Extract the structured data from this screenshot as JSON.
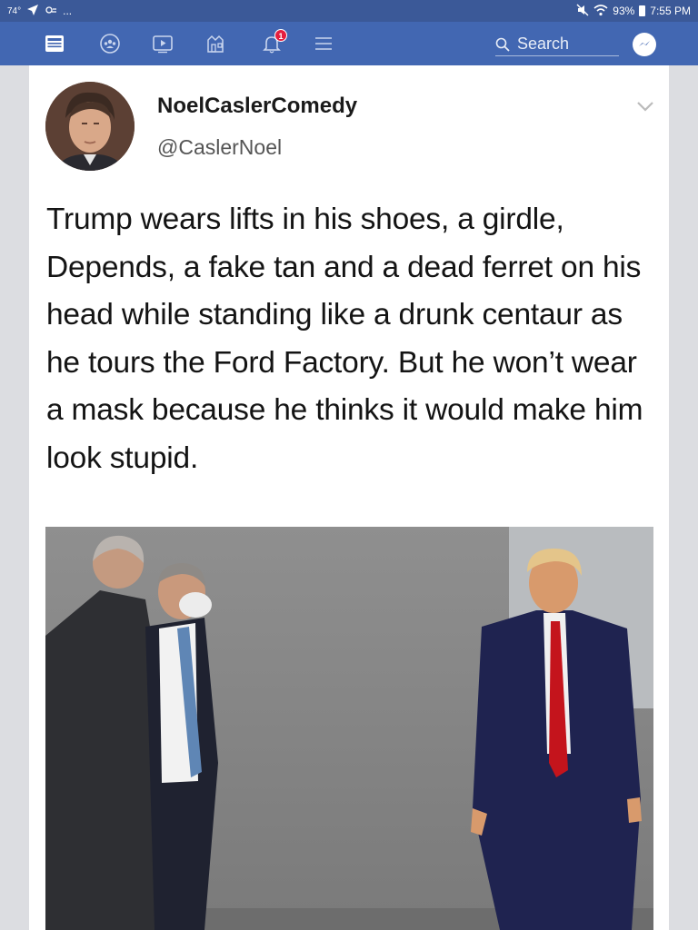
{
  "status_bar": {
    "temperature": "74°",
    "overflow": "...",
    "battery": "93%",
    "time": "7:55 PM"
  },
  "nav": {
    "icons": [
      "news-feed-icon",
      "groups-icon",
      "watch-icon",
      "marketplace-icon",
      "notifications-icon",
      "menu-icon"
    ],
    "notification_count": "1",
    "search_label": "Search"
  },
  "post": {
    "display_name": "NoelCaslerComedy",
    "handle": "@CaslerNoel",
    "text": "Trump wears lifts in his shoes, a girdle, Depends, a fake tan and a dead ferret on his head while standing like a drunk centaur as he tours the Ford Factory. But he won’t wear a mask because he thinks it would make him look stupid."
  },
  "colors": {
    "status_bar": "#3b5998",
    "nav_bar": "#4267b2",
    "badge": "#e41e3f",
    "page_bg": "#dcdde1"
  }
}
